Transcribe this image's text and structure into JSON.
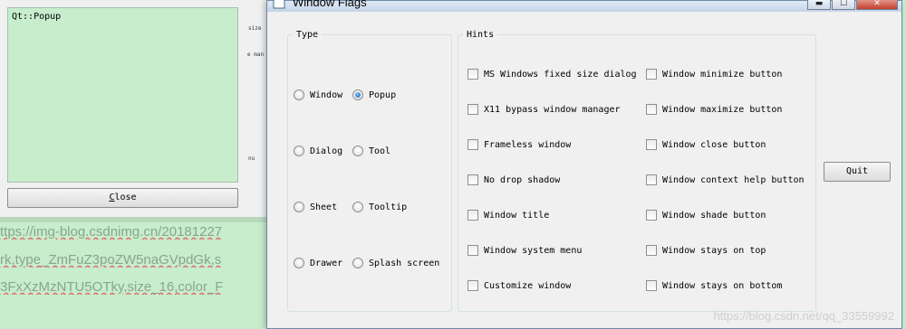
{
  "preview": {
    "text": "Qt::Popup",
    "close_label": "Close",
    "close_mnemonic": "C",
    "close_rest": "lose",
    "fragments": [
      "size",
      "e man",
      "nu"
    ]
  },
  "background": {
    "lines": [
      "ttps://img-blog.csdnimg.cn/20181227",
      "rk,type_ZmFuZ3poZW5naGVpdGk,s",
      "3FxXzMzNTU5OTky,size_16,color_F"
    ]
  },
  "dialog": {
    "title": "Window Flags",
    "buttons": {
      "minimize": "▬",
      "maximize": "☐",
      "close": "✕"
    },
    "type_group": {
      "title": "Type",
      "options": [
        {
          "label": "Window",
          "checked": false
        },
        {
          "label": "Popup",
          "checked": true
        },
        {
          "label": "Dialog",
          "checked": false
        },
        {
          "label": "Tool",
          "checked": false
        },
        {
          "label": "Sheet",
          "checked": false
        },
        {
          "label": "Tooltip",
          "checked": false
        },
        {
          "label": "Drawer",
          "checked": false
        },
        {
          "label": "Splash screen",
          "checked": false
        }
      ]
    },
    "hints_group": {
      "title": "Hints",
      "left": [
        "MS Windows fixed size dialog",
        "X11 bypass window manager",
        "Frameless window",
        "No drop shadow",
        "Window title",
        "Window system menu",
        "Customize window"
      ],
      "right": [
        "Window minimize button",
        "Window maximize button",
        "Window close button",
        "Window context help button",
        "Window shade button",
        "Window stays on top",
        "Window stays on bottom"
      ]
    },
    "quit_label": "Quit"
  },
  "watermark": "https://blog.csdn.net/qq_33559992",
  "colors": {
    "editor_green": "#c7edcc",
    "radio_checked": "#1c5fa8",
    "title_bar": "#c3d4e8",
    "close_button": "#c4402d"
  }
}
